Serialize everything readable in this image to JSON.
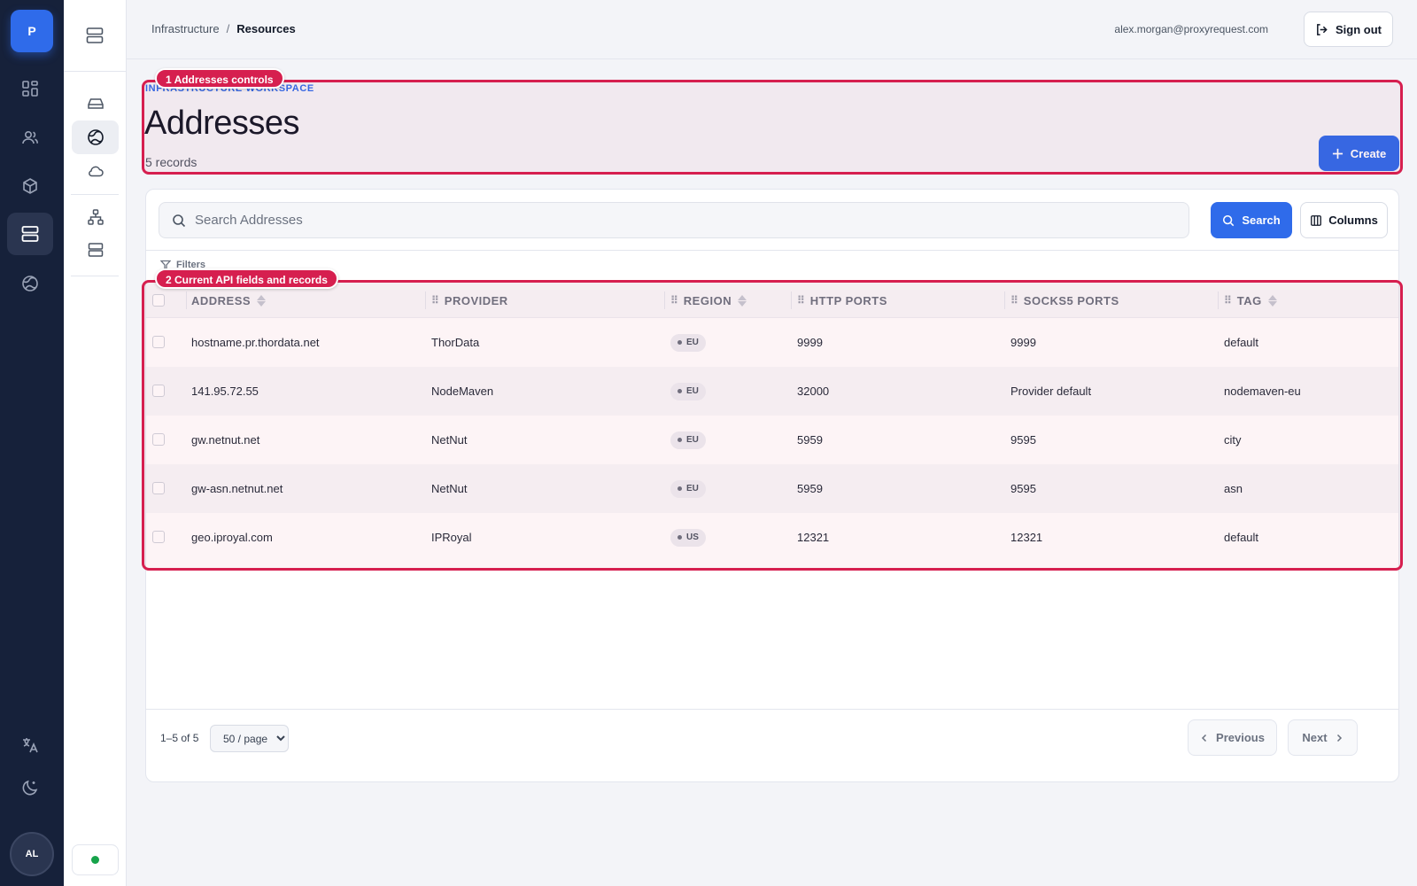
{
  "rail": {
    "logo_letter": "P",
    "icons": [
      "dashboard-icon",
      "users-icon",
      "package-icon",
      "server-icon",
      "globe-icon"
    ],
    "active_index": 3,
    "bottom_icons": [
      "translate-icon",
      "moon-icon"
    ],
    "avatar_initials": "AL"
  },
  "subnav": {
    "top_icon": "server-stack-icon",
    "icons": [
      "drive-icon",
      "globe-icon",
      "cloud-icon",
      "network-icon",
      "server-icon"
    ],
    "active_index": 1,
    "status_color": "#16a34a"
  },
  "topbar": {
    "breadcrumb": [
      "Infrastructure",
      "Resources"
    ],
    "separator": "/",
    "user_email": "alex.morgan@proxyrequest.com",
    "signout_label": "Sign out"
  },
  "header": {
    "kicker": "INFRASTRUCTURE WORKSPACE",
    "title": "Addresses",
    "record_count": "5 records",
    "create_label": "Create"
  },
  "annotations": [
    {
      "label": "1 Addresses controls"
    },
    {
      "label": "2 Current API fields and records"
    }
  ],
  "toolbar": {
    "search_placeholder": "Search Addresses",
    "search_label": "Search",
    "columns_label": "Columns",
    "filters_label": "Filters"
  },
  "table": {
    "columns": [
      "ADDRESS",
      "PROVIDER",
      "REGION",
      "HTTP PORTS",
      "SOCKS5 PORTS",
      "TAG"
    ],
    "rows": [
      {
        "address": "hostname.pr.thordata.net",
        "provider": "ThorData",
        "region": "EU",
        "http": "9999",
        "socks5": "9999",
        "tag": "default"
      },
      {
        "address": "141.95.72.55",
        "provider": "NodeMaven",
        "region": "EU",
        "http": "32000",
        "socks5": "Provider default",
        "tag": "nodemaven-eu"
      },
      {
        "address": "gw.netnut.net",
        "provider": "NetNut",
        "region": "EU",
        "http": "5959",
        "socks5": "9595",
        "tag": "city"
      },
      {
        "address": "gw-asn.netnut.net",
        "provider": "NetNut",
        "region": "EU",
        "http": "5959",
        "socks5": "9595",
        "tag": "asn"
      },
      {
        "address": "geo.iproyal.com",
        "provider": "IPRoyal",
        "region": "US",
        "http": "12321",
        "socks5": "12321",
        "tag": "default"
      }
    ]
  },
  "pagination": {
    "range": "1–5 of 5",
    "per_page": "50 / page",
    "per_page_options": [
      "50 / page"
    ],
    "previous_label": "Previous",
    "next_label": "Next"
  },
  "colors": {
    "accent": "#2f6bea",
    "rail_bg": "#16213a",
    "annotation": "#d61f4f"
  }
}
